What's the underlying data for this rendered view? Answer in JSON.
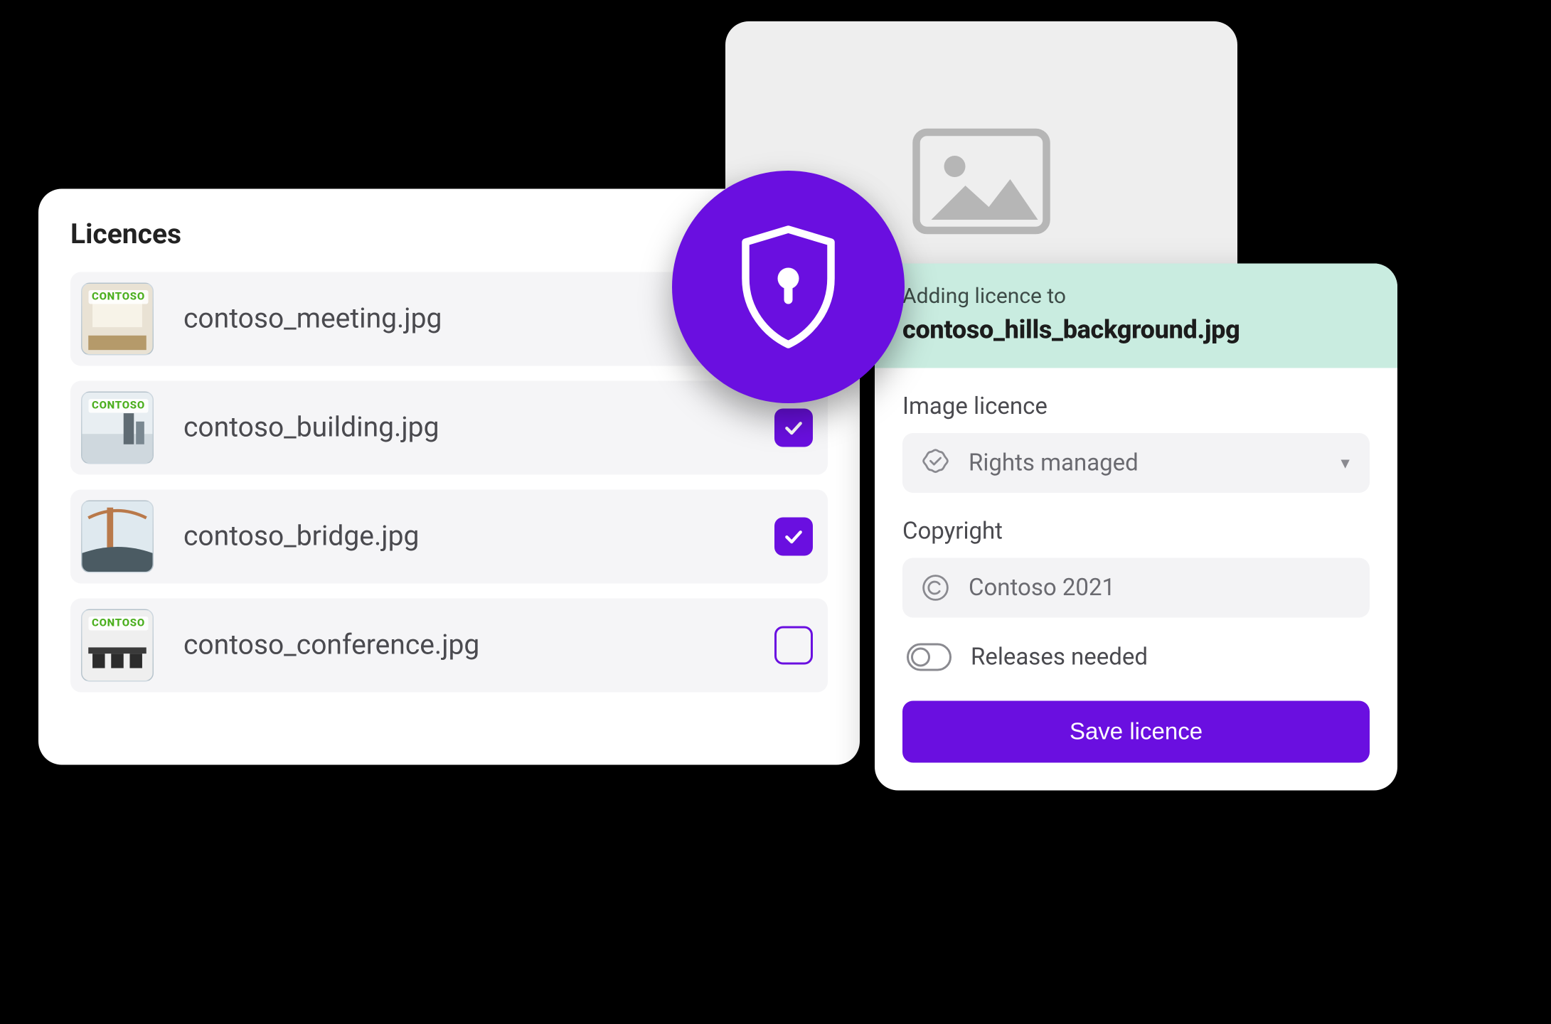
{
  "colors": {
    "accent": "#6a0fe0",
    "mint": "#c9ece0"
  },
  "licences": {
    "title": "Licences",
    "items": [
      {
        "filename": "contoso_meeting.jpg",
        "checked": null,
        "tag": "CONTOSO"
      },
      {
        "filename": "contoso_building.jpg",
        "checked": true,
        "tag": "CONTOSO"
      },
      {
        "filename": "contoso_bridge.jpg",
        "checked": true,
        "tag": ""
      },
      {
        "filename": "contoso_conference.jpg",
        "checked": false,
        "tag": "CONTOSO"
      }
    ]
  },
  "detail": {
    "subheading": "Adding licence to",
    "filename": "contoso_hills_background.jpg",
    "image_licence_label": "Image licence",
    "image_licence_value": "Rights managed",
    "copyright_label": "Copyright",
    "copyright_value": "Contoso 2021",
    "releases_label": "Releases needed",
    "releases_on": false,
    "save_label": "Save licence"
  },
  "badge": {
    "icon": "shield-lock-icon"
  },
  "preview": {
    "icon": "image-placeholder-icon"
  }
}
